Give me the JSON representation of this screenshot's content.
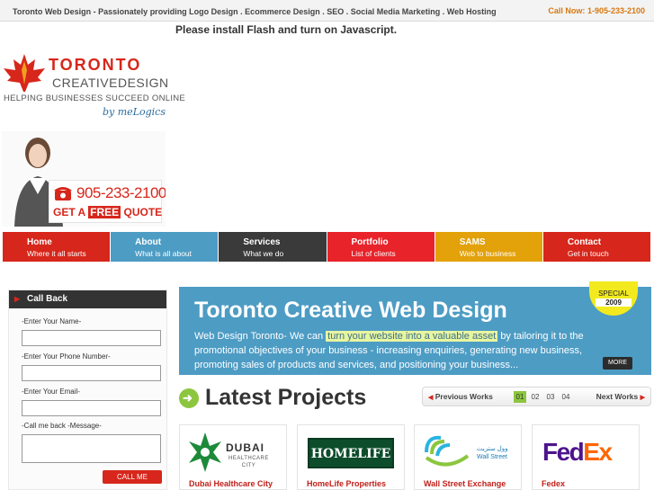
{
  "topbar": {
    "tagline": "Toronto Web Design - Passionately providing Logo Design . Ecommerce Design . SEO . Social Media Marketing . Web Hosting",
    "call_label": "Call Now:",
    "call_number": "1-905-233-2100"
  },
  "flash_message": "Please install Flash and turn on Javascript.",
  "logo": {
    "brand_line1": "TORONTO",
    "brand_line2": "CREATIVEDESIGN",
    "tagline": "HELPING BUSINESSES SUCCEED ONLINE",
    "byline": "by meLogics",
    "icon": "maple-leaf-icon"
  },
  "promo": {
    "phone": "905-233-2100",
    "quote_prefix": "GET A",
    "quote_free": "FREE",
    "quote_suffix": "QUOTE",
    "icon": "telephone-icon"
  },
  "nav": [
    {
      "title": "Home",
      "subtitle": "Where it all starts",
      "color": "#d7261b"
    },
    {
      "title": "About",
      "subtitle": "What is all about",
      "color": "#4d9cc4"
    },
    {
      "title": "Services",
      "subtitle": "What we do",
      "color": "#3a3a3a"
    },
    {
      "title": "Portfolio",
      "subtitle": "List of clients",
      "color": "#e8232a"
    },
    {
      "title": "SAMS",
      "subtitle": "Web to business",
      "color": "#e3a10a"
    },
    {
      "title": "Contact",
      "subtitle": "Get in touch",
      "color": "#d7261b"
    }
  ],
  "callback": {
    "heading": "Call Back",
    "name_label": "-Enter Your Name-",
    "phone_label": "-Enter Your Phone Number-",
    "email_label": "-Enter Your Email-",
    "message_label": "-Call me back -Message-",
    "button": "CALL ME"
  },
  "banner": {
    "title": "Toronto Creative Web Design",
    "text_before": "Web Design Toronto- We can",
    "text_highlight": "turn your website into a valuable asset",
    "text_after": "by tailoring it to the promotional objectives of your business - increasing enquiries, generating new business, promoting sales of products and services, and positioning your business...",
    "more": "MORE",
    "special_line1": "SPECIAL",
    "special_line2": "2009"
  },
  "latest": {
    "title": "Latest Projects",
    "prev": "Previous Works",
    "next": "Next Works",
    "pages": [
      "01",
      "02",
      "03",
      "04"
    ],
    "active_page": "01"
  },
  "projects": [
    {
      "caption": "Dubai Healthcare City",
      "logo_text": "DUBAI",
      "logo_sub1": "HEALTHCARE",
      "logo_sub2": "CITY"
    },
    {
      "caption": "HomeLife Properties",
      "logo_text": "HOMELIFE"
    },
    {
      "caption": "Wall Street Exchange",
      "logo_text": "Wall Street",
      "logo_arabic": "وول ستريت"
    },
    {
      "caption": "Fedex",
      "logo_fe": "Fed",
      "logo_ex": "Ex"
    }
  ]
}
